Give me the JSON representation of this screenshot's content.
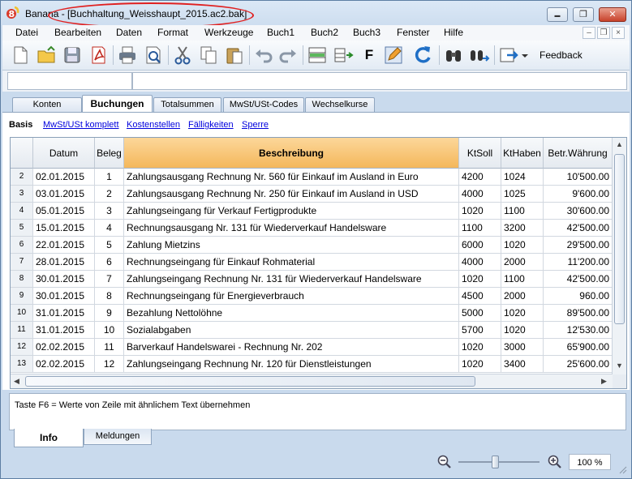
{
  "window": {
    "app_name": "Banana",
    "title": "Banana - [Buchhaltung_Weisshaupt_2015.ac2.bak]",
    "buttons": {
      "minimize": "▬",
      "maximize": "❐",
      "close": "✕"
    }
  },
  "menu": {
    "items": [
      "Datei",
      "Bearbeiten",
      "Daten",
      "Format",
      "Werkzeuge",
      "Buch1",
      "Buch2",
      "Buch3",
      "Fenster",
      "Hilfe"
    ],
    "mdi": {
      "minimize": "–",
      "restore": "❐",
      "close": "×"
    }
  },
  "toolbar": {
    "icons": [
      "new-file-icon",
      "open-file-icon",
      "save-icon",
      "pdf-icon",
      "print-icon",
      "print-preview-icon",
      "cut-icon",
      "copy-icon",
      "paste-icon",
      "undo-icon",
      "redo-icon",
      "insert-rows-icon",
      "move-rows-icon",
      "bold-icon",
      "edit-pencil-icon",
      "recheck-icon",
      "find-icon",
      "replace-icon",
      "export-icon"
    ],
    "bold_label": "F",
    "feedback": "Feedback"
  },
  "formula": {
    "cell_ref": "",
    "content": ""
  },
  "tabs": [
    "Konten",
    "Buchungen",
    "Totalsummen",
    "MwSt/USt-Codes",
    "Wechselkurse"
  ],
  "active_tab": "Buchungen",
  "views": {
    "active": "Basis",
    "links": [
      "MwSt/USt komplett",
      "Kostenstellen",
      "Fälligkeiten",
      "Sperre"
    ]
  },
  "table": {
    "columns": [
      "Datum",
      "Beleg",
      "Beschreibung",
      "KtSoll",
      "KtHaben",
      "Betr.Währung"
    ],
    "rows": [
      {
        "rn": "2",
        "date": "02.01.2015",
        "doc": "1",
        "desc": "Zahlungsausgang Rechnung Nr. 560 für Einkauf im Ausland in Euro",
        "debit": "4200",
        "credit": "1024",
        "amount": "10'500.00"
      },
      {
        "rn": "3",
        "date": "03.01.2015",
        "doc": "2",
        "desc": "Zahlungsausgang Rechnung Nr. 250 für Einkauf im Ausland in USD",
        "debit": "4000",
        "credit": "1025",
        "amount": "9'600.00"
      },
      {
        "rn": "4",
        "date": "05.01.2015",
        "doc": "3",
        "desc": "Zahlungseingang für Verkauf Fertigprodukte",
        "debit": "1020",
        "credit": "1100",
        "amount": "30'600.00"
      },
      {
        "rn": "5",
        "date": "15.01.2015",
        "doc": "4",
        "desc": "Rechnungsausgang Nr. 131 für Wiederverkauf Handelsware",
        "debit": "1100",
        "credit": "3200",
        "amount": "42'500.00"
      },
      {
        "rn": "6",
        "date": "22.01.2015",
        "doc": "5",
        "desc": "Zahlung Mietzins",
        "debit": "6000",
        "credit": "1020",
        "amount": "29'500.00"
      },
      {
        "rn": "7",
        "date": "28.01.2015",
        "doc": "6",
        "desc": "Rechnungseingang für Einkauf Rohmaterial",
        "debit": "4000",
        "credit": "2000",
        "amount": "11'200.00"
      },
      {
        "rn": "8",
        "date": "30.01.2015",
        "doc": "7",
        "desc": "Zahlungseingang Rechnung Nr. 131 für Wiederverkauf Handelsware",
        "debit": "1020",
        "credit": "1100",
        "amount": "42'500.00"
      },
      {
        "rn": "9",
        "date": "30.01.2015",
        "doc": "8",
        "desc": "Rechnungseingang für Energieverbrauch",
        "debit": "4500",
        "credit": "2000",
        "amount": "960.00"
      },
      {
        "rn": "10",
        "date": "31.01.2015",
        "doc": "9",
        "desc": "Bezahlung Nettolöhne",
        "debit": "5000",
        "credit": "1020",
        "amount": "89'500.00"
      },
      {
        "rn": "11",
        "date": "31.01.2015",
        "doc": "10",
        "desc": "Sozialabgaben",
        "debit": "5700",
        "credit": "1020",
        "amount": "12'530.00"
      },
      {
        "rn": "12",
        "date": "02.02.2015",
        "doc": "11",
        "desc": "Barverkauf Handelswarei - Rechnung Nr. 202",
        "debit": "1020",
        "credit": "3000",
        "amount": "65'900.00"
      },
      {
        "rn": "13",
        "date": "02.02.2015",
        "doc": "12",
        "desc": "Zahlungseingang Rechnung Nr. 120 für Dienstleistungen",
        "debit": "1020",
        "credit": "3400",
        "amount": "25'600.00"
      }
    ]
  },
  "info": {
    "text": "Taste F6 = Werte von Zeile mit ähnlichem Text übernehmen"
  },
  "bottom_tabs": [
    "Info",
    "Meldungen"
  ],
  "zoom": {
    "value": "100 %",
    "level": 0.45
  }
}
